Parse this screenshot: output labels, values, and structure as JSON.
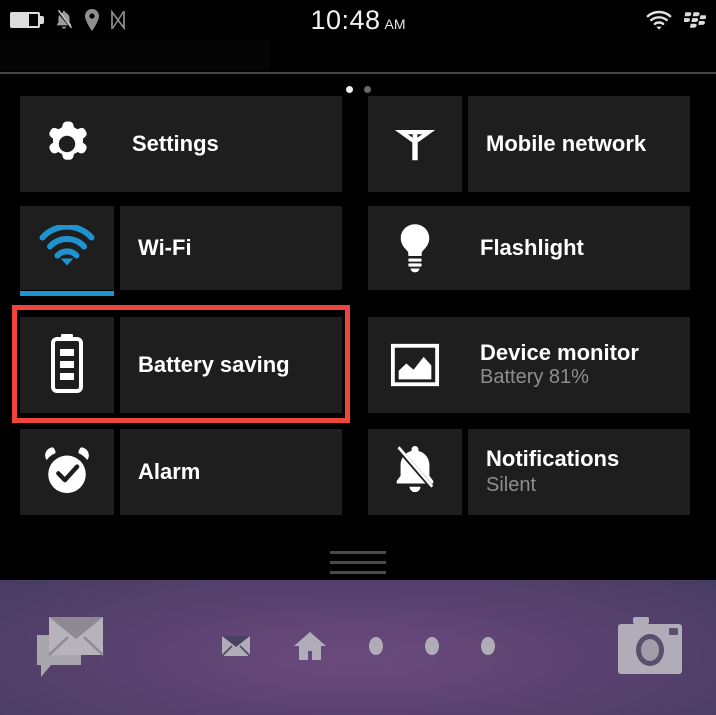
{
  "status_bar": {
    "time": "10:48",
    "ampm": "AM",
    "icons_left": [
      "battery-icon",
      "bell-muted-icon",
      "location-pin-icon",
      "nfc-icon"
    ],
    "icons_right": [
      "wifi-icon",
      "blackberry-logo-icon"
    ],
    "battery_level_percent": 81
  },
  "panel": {
    "page_dots": 2,
    "active_page_index": 0
  },
  "colors": {
    "accent_blue": "#1f93d0",
    "highlight_red": "#f0443c",
    "tile_bg": "#1e1e1e",
    "screen_bg": "#000000",
    "subtitle_gray": "#8e8e8e"
  },
  "tiles": {
    "left_column": [
      {
        "id": "settings",
        "label": "Settings",
        "sublabel": "",
        "icon": "gear-icon",
        "layout": "joined",
        "active": false,
        "highlighted": false
      },
      {
        "id": "wifi",
        "label": "Wi-Fi",
        "sublabel": "",
        "icon": "wifi-icon",
        "layout": "split",
        "active": true,
        "highlighted": false
      },
      {
        "id": "battery-saving",
        "label": "Battery saving",
        "sublabel": "",
        "icon": "battery-icon",
        "layout": "split",
        "active": false,
        "highlighted": true
      },
      {
        "id": "alarm",
        "label": "Alarm",
        "sublabel": "",
        "icon": "alarm-clock-icon",
        "layout": "split",
        "active": false,
        "highlighted": false
      }
    ],
    "right_column": [
      {
        "id": "mobile-network",
        "label": "Mobile network",
        "sublabel": "",
        "icon": "antenna-icon",
        "layout": "split",
        "active": false,
        "highlighted": false
      },
      {
        "id": "flashlight",
        "label": "Flashlight",
        "sublabel": "",
        "icon": "lightbulb-icon",
        "layout": "joined",
        "active": false,
        "highlighted": false
      },
      {
        "id": "device-monitor",
        "label": "Device monitor",
        "sublabel": "Battery 81%",
        "icon": "chart-frame-icon",
        "layout": "joined",
        "active": false,
        "highlighted": false
      },
      {
        "id": "notifications",
        "label": "Notifications",
        "sublabel": "Silent",
        "icon": "bell-muted-icon",
        "layout": "split",
        "active": false,
        "highlighted": false
      }
    ]
  },
  "handle": {
    "name": "drag-handle",
    "bars": 3
  },
  "dock": {
    "hub_icon": "hub-messages-icon",
    "camera_icon": "camera-icon",
    "center_items": [
      "email-icon",
      "home-icon",
      "app-dot-1",
      "app-dot-2",
      "app-dot-3"
    ]
  }
}
